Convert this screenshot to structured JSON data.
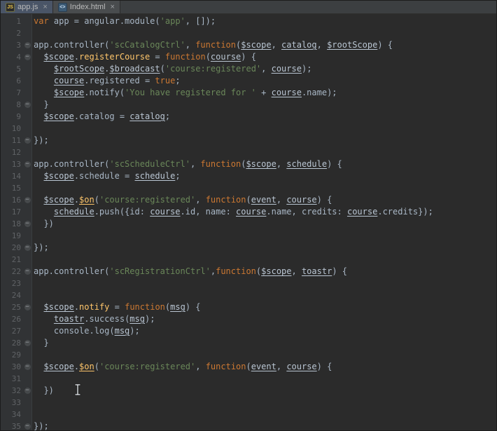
{
  "tabs": [
    {
      "label": "app.js",
      "icon_text": "JS",
      "close": "×",
      "active": true
    },
    {
      "label": "Index.html",
      "icon_text": "<>",
      "close": "×",
      "active": false
    }
  ],
  "editor": {
    "background": "#2b2b2b",
    "gutter_background": "#313335",
    "fold_glyph": "−",
    "colors": {
      "keyword": "#cc7832",
      "string": "#6a8759",
      "plain": "#a9b7c6",
      "underlined_identifier": "#bac6d3",
      "function_name": "#ffc66b",
      "line_number": "#606366"
    },
    "lines": [
      {
        "n": 1,
        "fold": "",
        "t": [
          [
            "var",
            "kw"
          ],
          [
            " app = angular.module(",
            "pl"
          ],
          [
            "'app'",
            "str"
          ],
          [
            ", []);",
            "pl"
          ]
        ]
      },
      {
        "n": 2,
        "fold": "",
        "t": []
      },
      {
        "n": 3,
        "fold": "start",
        "t": [
          [
            "app.controller(",
            "pl"
          ],
          [
            "'scCatalogCtrl'",
            "str"
          ],
          [
            ", ",
            "pl"
          ],
          [
            "function",
            "kw"
          ],
          [
            "(",
            "pl"
          ],
          [
            "$scope",
            "var"
          ],
          [
            ", ",
            "pl"
          ],
          [
            "catalog",
            "var"
          ],
          [
            ", ",
            "pl"
          ],
          [
            "$rootScope",
            "var"
          ],
          [
            ") {",
            "pl"
          ]
        ]
      },
      {
        "n": 4,
        "fold": "start",
        "t": [
          [
            "  ",
            "pl"
          ],
          [
            "$scope",
            "var"
          ],
          [
            ".",
            "pl"
          ],
          [
            "registerCourse",
            "fn"
          ],
          [
            " = ",
            "pl"
          ],
          [
            "function",
            "kw"
          ],
          [
            "(",
            "pl"
          ],
          [
            "course",
            "var"
          ],
          [
            ") {",
            "pl"
          ]
        ]
      },
      {
        "n": 5,
        "fold": "",
        "t": [
          [
            "    ",
            "pl"
          ],
          [
            "$rootScope",
            "var"
          ],
          [
            ".",
            "pl"
          ],
          [
            "$broadcast",
            "var"
          ],
          [
            "(",
            "pl"
          ],
          [
            "'course:registered'",
            "str"
          ],
          [
            ", ",
            "pl"
          ],
          [
            "course",
            "var"
          ],
          [
            ");",
            "pl"
          ]
        ]
      },
      {
        "n": 6,
        "fold": "",
        "t": [
          [
            "    ",
            "pl"
          ],
          [
            "course",
            "var"
          ],
          [
            ".registered = ",
            "pl"
          ],
          [
            "true",
            "kw"
          ],
          [
            ";",
            "pl"
          ]
        ]
      },
      {
        "n": 7,
        "fold": "",
        "t": [
          [
            "    ",
            "pl"
          ],
          [
            "$scope",
            "var"
          ],
          [
            ".notify(",
            "pl"
          ],
          [
            "'You have registered for '",
            "str"
          ],
          [
            " + ",
            "pl"
          ],
          [
            "course",
            "var"
          ],
          [
            ".name);",
            "pl"
          ]
        ]
      },
      {
        "n": 8,
        "fold": "end",
        "t": [
          [
            "  }",
            "pl"
          ]
        ]
      },
      {
        "n": 9,
        "fold": "",
        "t": [
          [
            "  ",
            "pl"
          ],
          [
            "$scope",
            "var"
          ],
          [
            ".catalog = ",
            "pl"
          ],
          [
            "catalog",
            "var"
          ],
          [
            ";",
            "pl"
          ]
        ]
      },
      {
        "n": 10,
        "fold": "",
        "t": []
      },
      {
        "n": 11,
        "fold": "end",
        "t": [
          [
            "});",
            "pl"
          ]
        ]
      },
      {
        "n": 12,
        "fold": "",
        "t": []
      },
      {
        "n": 13,
        "fold": "start",
        "t": [
          [
            "app.controller(",
            "pl"
          ],
          [
            "'scScheduleCtrl'",
            "str"
          ],
          [
            ", ",
            "pl"
          ],
          [
            "function",
            "kw"
          ],
          [
            "(",
            "pl"
          ],
          [
            "$scope",
            "var"
          ],
          [
            ", ",
            "pl"
          ],
          [
            "schedule",
            "var"
          ],
          [
            ") {",
            "pl"
          ]
        ]
      },
      {
        "n": 14,
        "fold": "",
        "t": [
          [
            "  ",
            "pl"
          ],
          [
            "$scope",
            "var"
          ],
          [
            ".schedule = ",
            "pl"
          ],
          [
            "schedule",
            "var"
          ],
          [
            ";",
            "pl"
          ]
        ]
      },
      {
        "n": 15,
        "fold": "",
        "t": []
      },
      {
        "n": 16,
        "fold": "start",
        "t": [
          [
            "  ",
            "pl"
          ],
          [
            "$scope",
            "var"
          ],
          [
            ".",
            "pl"
          ],
          [
            "$on",
            "fnu"
          ],
          [
            "(",
            "pl"
          ],
          [
            "'course:registered'",
            "str"
          ],
          [
            ", ",
            "pl"
          ],
          [
            "function",
            "kw"
          ],
          [
            "(",
            "pl"
          ],
          [
            "event",
            "var"
          ],
          [
            ", ",
            "pl"
          ],
          [
            "course",
            "var"
          ],
          [
            ") {",
            "pl"
          ]
        ]
      },
      {
        "n": 17,
        "fold": "",
        "t": [
          [
            "    ",
            "pl"
          ],
          [
            "schedule",
            "var"
          ],
          [
            ".push({id: ",
            "pl"
          ],
          [
            "course",
            "var"
          ],
          [
            ".id, name: ",
            "pl"
          ],
          [
            "course",
            "var"
          ],
          [
            ".name, credits: ",
            "pl"
          ],
          [
            "course",
            "var"
          ],
          [
            ".credits});",
            "pl"
          ]
        ]
      },
      {
        "n": 18,
        "fold": "end",
        "t": [
          [
            "  })",
            "pl"
          ]
        ]
      },
      {
        "n": 19,
        "fold": "",
        "t": []
      },
      {
        "n": 20,
        "fold": "end",
        "t": [
          [
            "});",
            "pl"
          ]
        ]
      },
      {
        "n": 21,
        "fold": "",
        "t": []
      },
      {
        "n": 22,
        "fold": "start",
        "t": [
          [
            "app.controller(",
            "pl"
          ],
          [
            "'scRegistrationCtrl'",
            "str"
          ],
          [
            ",",
            "pl"
          ],
          [
            "function",
            "kw"
          ],
          [
            "(",
            "pl"
          ],
          [
            "$scope",
            "var"
          ],
          [
            ", ",
            "pl"
          ],
          [
            "toastr",
            "var"
          ],
          [
            ") {",
            "pl"
          ]
        ]
      },
      {
        "n": 23,
        "fold": "",
        "t": []
      },
      {
        "n": 24,
        "fold": "",
        "t": []
      },
      {
        "n": 25,
        "fold": "start",
        "t": [
          [
            "  ",
            "pl"
          ],
          [
            "$scope",
            "var"
          ],
          [
            ".",
            "pl"
          ],
          [
            "notify",
            "fn"
          ],
          [
            " = ",
            "pl"
          ],
          [
            "function",
            "kw"
          ],
          [
            "(",
            "pl"
          ],
          [
            "msg",
            "var"
          ],
          [
            ") {",
            "pl"
          ]
        ]
      },
      {
        "n": 26,
        "fold": "",
        "t": [
          [
            "    ",
            "pl"
          ],
          [
            "toastr",
            "var"
          ],
          [
            ".success(",
            "pl"
          ],
          [
            "msg",
            "var"
          ],
          [
            ");",
            "pl"
          ]
        ]
      },
      {
        "n": 27,
        "fold": "",
        "t": [
          [
            "    console.log(",
            "pl"
          ],
          [
            "msg",
            "var"
          ],
          [
            ");",
            "pl"
          ]
        ]
      },
      {
        "n": 28,
        "fold": "end",
        "t": [
          [
            "  }",
            "pl"
          ]
        ]
      },
      {
        "n": 29,
        "fold": "",
        "t": []
      },
      {
        "n": 30,
        "fold": "start",
        "t": [
          [
            "  ",
            "pl"
          ],
          [
            "$scope",
            "var"
          ],
          [
            ".",
            "pl"
          ],
          [
            "$on",
            "fnu"
          ],
          [
            "(",
            "pl"
          ],
          [
            "'course:registered'",
            "str"
          ],
          [
            ", ",
            "pl"
          ],
          [
            "function",
            "kw"
          ],
          [
            "(",
            "pl"
          ],
          [
            "event",
            "var"
          ],
          [
            ", ",
            "pl"
          ],
          [
            "course",
            "var"
          ],
          [
            ") {",
            "pl"
          ]
        ]
      },
      {
        "n": 31,
        "fold": "",
        "t": []
      },
      {
        "n": 32,
        "fold": "end",
        "t": [
          [
            "  })",
            "pl"
          ]
        ]
      },
      {
        "n": 33,
        "fold": "",
        "t": []
      },
      {
        "n": 34,
        "fold": "",
        "t": []
      },
      {
        "n": 35,
        "fold": "end",
        "t": [
          [
            "});",
            "pl"
          ]
        ]
      }
    ]
  },
  "cursor": {
    "type": "text-ibeam",
    "near_line": 31
  }
}
